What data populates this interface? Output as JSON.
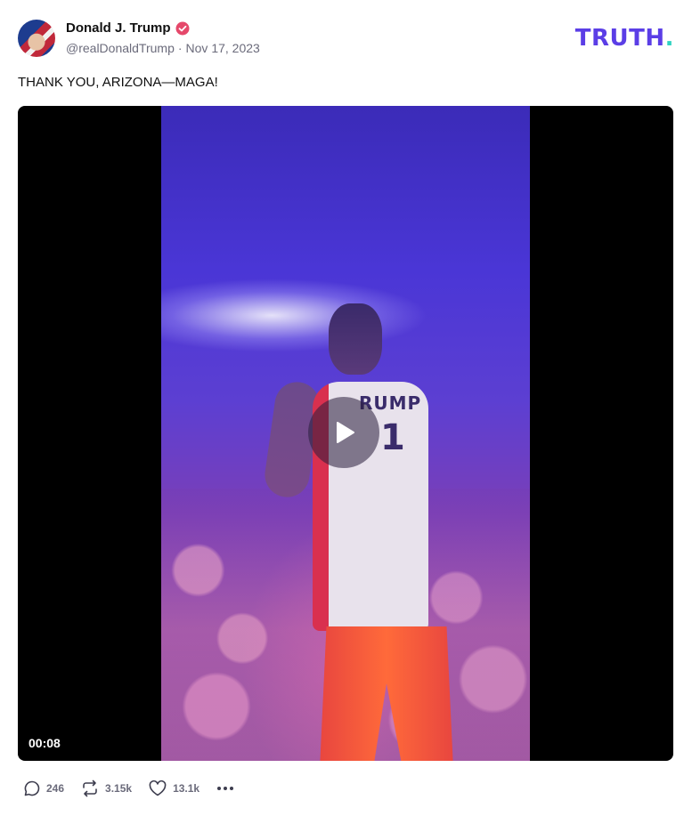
{
  "post": {
    "author_name": "Donald J. Trump",
    "handle": "@realDonaldTrump",
    "separator": "·",
    "date": "Nov 17, 2023",
    "text": "THANK YOU, ARIZONA—MAGA!",
    "verified": true
  },
  "brand": {
    "logo_text": "TRUTH",
    "logo_dot": ".",
    "accent_color": "#5b3ee6",
    "dot_color": "#2fd3c1"
  },
  "video": {
    "duration": "00:08",
    "jersey_text": "RUMP",
    "jersey_number": "1",
    "play_icon": "play-icon"
  },
  "actions": {
    "replies": "246",
    "retruths": "3.15k",
    "likes": "13.1k",
    "icons": [
      "comment-icon",
      "retruth-icon",
      "heart-icon",
      "more-icon"
    ]
  }
}
